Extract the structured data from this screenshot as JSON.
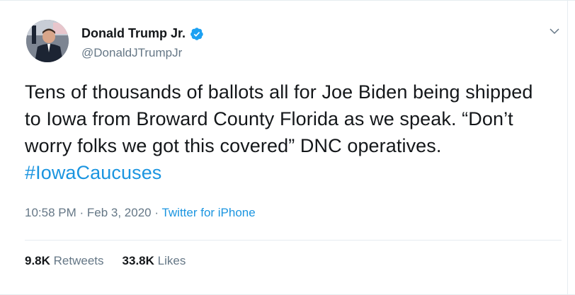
{
  "author": {
    "display_name": "Donald Trump Jr.",
    "handle": "@DonaldJTrumpJr",
    "verified": true
  },
  "tweet": {
    "text": "Tens of thousands of ballots all for Joe Biden being shipped to Iowa from Broward County Florida as we speak. “Don’t worry folks we got this covered” DNC operatives. ",
    "hashtag": "#IowaCaucuses"
  },
  "meta": {
    "time": "10:58 PM",
    "sep1": " · ",
    "date": "Feb 3, 2020",
    "sep2": " · ",
    "source": "Twitter for iPhone"
  },
  "stats": {
    "retweets_count": "9.8K",
    "retweets_label": "Retweets",
    "likes_count": "33.8K",
    "likes_label": "Likes"
  },
  "icons": {
    "verified": "verified-badge-icon",
    "menu": "chevron-down-icon"
  },
  "colors": {
    "link": "#1b95e0",
    "muted": "#657786",
    "text": "#14171a",
    "verified": "#1da1f2"
  }
}
